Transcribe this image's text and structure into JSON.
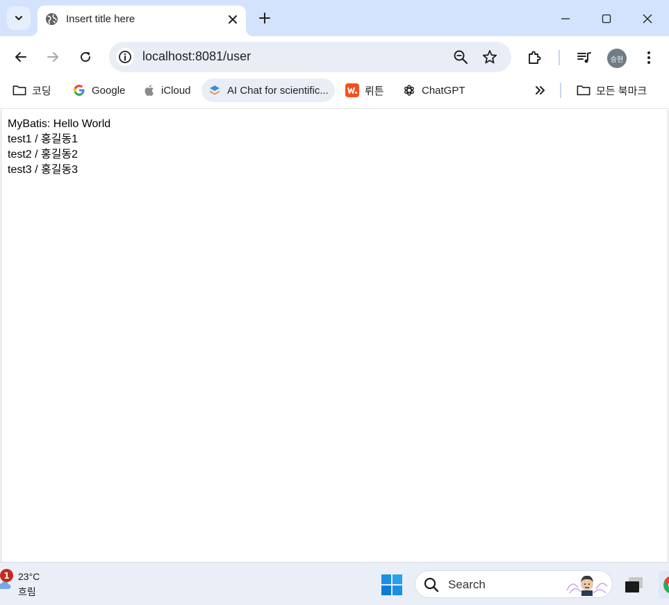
{
  "browser": {
    "tab": {
      "title": "Insert title here"
    },
    "address_bar": {
      "url": "localhost:8081/user"
    },
    "profile": {
      "initials": "승현"
    },
    "bookmarks": [
      {
        "label": "코딩",
        "icon": "folder-icon"
      },
      {
        "label": "Google",
        "icon": "google-icon"
      },
      {
        "label": "iCloud",
        "icon": "apple-icon"
      },
      {
        "label": "AI Chat for scientific...",
        "icon": "layers-icon"
      },
      {
        "label": "뤼튼",
        "icon": "wrtn-icon"
      },
      {
        "label": "ChatGPT",
        "icon": "chatgpt-icon"
      }
    ],
    "all_bookmarks": {
      "label": "모든 북마크",
      "icon": "folder-icon"
    }
  },
  "page": {
    "lines": [
      "MyBatis: Hello World",
      "test1 / 홍길동1",
      "test2 / 홍길동2",
      "test3 / 홍길동3"
    ]
  },
  "taskbar": {
    "weather": {
      "notification_count": "1",
      "temperature": "23°C",
      "condition": "흐림"
    },
    "search": {
      "label": "Search"
    }
  },
  "colors": {
    "tabstrip": "#d3e3fd",
    "omnibox": "#e9eef6",
    "taskbar": "#eaeff7",
    "notification_badge": "#c42b1c"
  }
}
